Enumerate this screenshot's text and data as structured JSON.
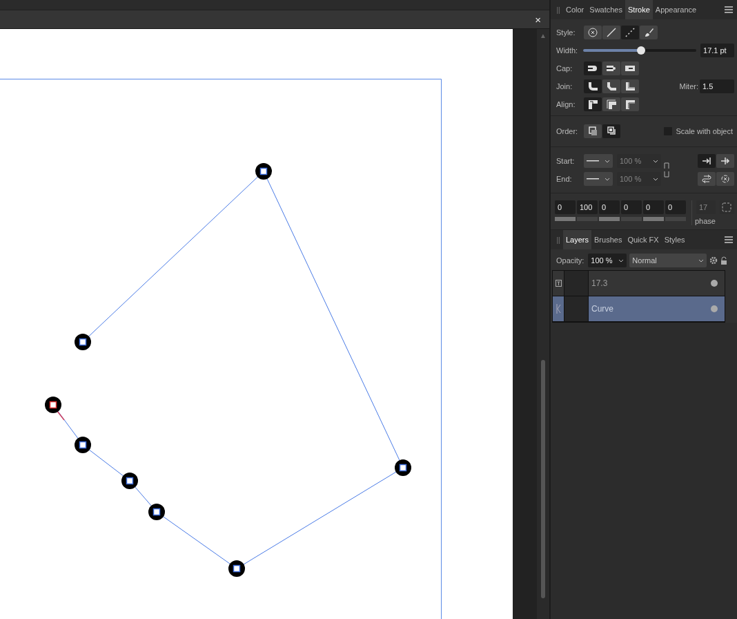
{
  "document": {
    "close": "×",
    "scroll_up": "▲"
  },
  "stroke_panel": {
    "grip": "||",
    "tabs": [
      {
        "label": "Color",
        "selected": false
      },
      {
        "label": "Swatches",
        "selected": false
      },
      {
        "label": "Stroke",
        "selected": true
      },
      {
        "label": "Appearance",
        "selected": false
      }
    ],
    "style": {
      "label": "Style:",
      "options": [
        {
          "kind": "none",
          "selected": false
        },
        {
          "kind": "solid",
          "selected": false
        },
        {
          "kind": "dash",
          "selected": true
        },
        {
          "kind": "brush",
          "selected": false
        }
      ]
    },
    "width": {
      "label": "Width:",
      "level": 0.51,
      "value": "17.1 pt"
    },
    "cap": {
      "label": "Cap:",
      "options": [
        {
          "kind": "cap-butt",
          "selected": true
        },
        {
          "kind": "cap-round",
          "selected": false
        },
        {
          "kind": "cap-square",
          "selected": false
        }
      ]
    },
    "join": {
      "label": "Join:",
      "options": [
        {
          "kind": "join-round",
          "selected": true
        },
        {
          "kind": "join-bevel",
          "selected": false
        },
        {
          "kind": "join-miter",
          "selected": false
        }
      ]
    },
    "miter": {
      "label": "Miter:",
      "value": "1.5"
    },
    "align": {
      "label": "Align:",
      "options": [
        {
          "kind": "align-center",
          "selected": true
        },
        {
          "kind": "align-inside",
          "selected": false
        },
        {
          "kind": "align-outside",
          "selected": false
        }
      ]
    },
    "order": {
      "label": "Order:",
      "options": [
        {
          "kind": "order-behind",
          "selected": false
        },
        {
          "kind": "order-front",
          "selected": true
        }
      ]
    },
    "scale_with_object": {
      "label": "Scale with object",
      "checked": false
    },
    "start": {
      "label": "Start:",
      "size": "100 %"
    },
    "end": {
      "label": "End:",
      "size": "100 %"
    },
    "arrow_buttons": [
      {
        "kind": "arrow-end",
        "selected": true
      },
      {
        "kind": "arrow-past",
        "selected": false
      },
      {
        "kind": "swap",
        "selected": false
      },
      {
        "kind": "reset",
        "selected": false
      }
    ],
    "dash": [
      "0",
      "100",
      "0",
      "0",
      "0",
      "0"
    ],
    "phase": {
      "placeholder": "17",
      "label": "phase"
    }
  },
  "layers_panel": {
    "grip": "||",
    "tabs": [
      {
        "label": "Layers",
        "selected": true
      },
      {
        "label": "Brushes",
        "selected": false
      },
      {
        "label": "Quick FX",
        "selected": false
      },
      {
        "label": "Styles",
        "selected": false
      }
    ],
    "opacity": {
      "label": "Opacity:",
      "value": "100 %"
    },
    "blend_mode": "Normal",
    "layers": [
      {
        "kind": "text",
        "name": "17.3",
        "selected": false
      },
      {
        "kind": "curve",
        "name": "Curve",
        "selected": true
      }
    ]
  }
}
